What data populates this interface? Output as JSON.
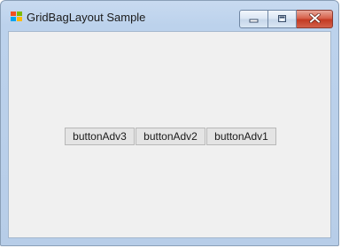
{
  "window": {
    "title": "GridBagLayout Sample"
  },
  "title_bar": {
    "app_icon": "windows-app-icon",
    "minimize_icon": "minimize-icon",
    "maximize_icon": "maximize-icon",
    "close_icon": "close-icon"
  },
  "buttons": [
    {
      "label": "buttonAdv3"
    },
    {
      "label": "buttonAdv2"
    },
    {
      "label": "buttonAdv1"
    }
  ],
  "colors": {
    "client_background": "#f0f0f0",
    "close_button": "#c8432b",
    "frame": "#bcd2ec"
  }
}
